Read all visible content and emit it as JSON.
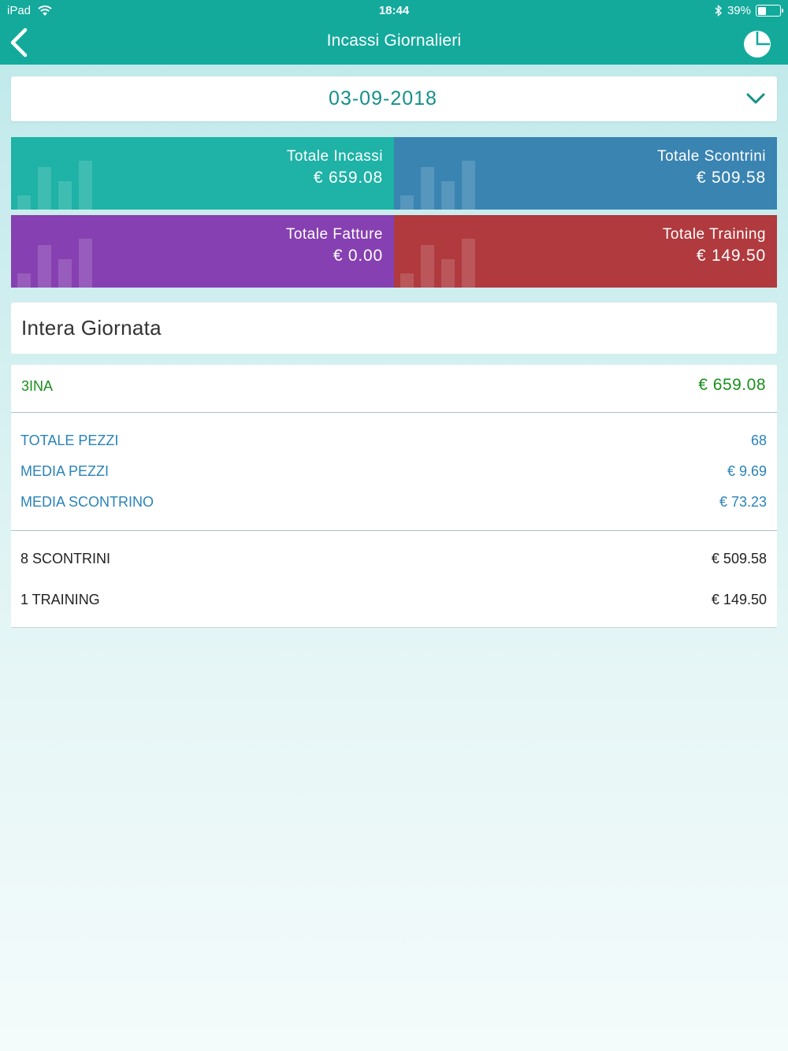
{
  "status": {
    "device": "iPad",
    "time": "18:44",
    "battery_text": "39%",
    "battery_level": 0.39
  },
  "nav": {
    "title": "Incassi Giornalieri"
  },
  "date_selector": {
    "value": "03-09-2018"
  },
  "tiles": [
    {
      "label": "Totale Incassi",
      "value": "€ 659.08",
      "color": "#1fb2a6"
    },
    {
      "label": "Totale Scontrini",
      "value": "€ 509.58",
      "color": "#3a84b2"
    },
    {
      "label": "Totale Fatture",
      "value": "€ 0.00",
      "color": "#8640b1"
    },
    {
      "label": "Totale Training",
      "value": "€ 149.50",
      "color": "#b03a3e"
    }
  ],
  "section": {
    "title": "Intera Giornata"
  },
  "store": {
    "name": "3INA",
    "total": "€ 659.08"
  },
  "stats": [
    {
      "label": "TOTALE PEZZI",
      "value": "68"
    },
    {
      "label": "MEDIA PEZZI",
      "value": "€ 9.69"
    },
    {
      "label": "MEDIA SCONTRINO",
      "value": "€ 73.23"
    }
  ],
  "totals": [
    {
      "label": "8 SCONTRINI",
      "value": "€ 509.58"
    },
    {
      "label": "1 TRAINING",
      "value": "€ 149.50"
    }
  ],
  "colors": {
    "header": "#13aa9c",
    "date_text": "#15908a",
    "store_green": "#1a8f1c",
    "stat_blue": "#2a83b8"
  }
}
